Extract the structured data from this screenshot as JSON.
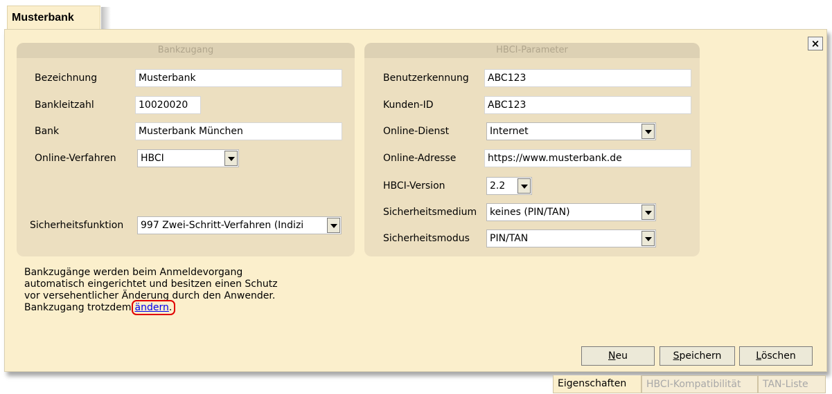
{
  "tab_title": "Musterbank",
  "close_label": "×",
  "bankzugang": {
    "header": "Bankzugang",
    "bezeichnung_label": "Bezeichnung",
    "bezeichnung_value": "Musterbank",
    "blz_label": "Bankleitzahl",
    "blz_value": "10020020",
    "bank_label": "Bank",
    "bank_value": "Musterbank München",
    "verfahren_label": "Online-Verfahren",
    "verfahren_value": "HBCI",
    "sicherheitsfunktion_label": "Sicherheitsfunktion",
    "sicherheitsfunktion_value": "997 Zwei-Schritt-Verfahren (Indizi"
  },
  "hbci": {
    "header": "HBCI-Parameter",
    "benutzer_label": "Benutzerkennung",
    "benutzer_value": "ABC123",
    "kunden_label": "Kunden-ID",
    "kunden_value": "ABC123",
    "dienst_label": "Online-Dienst",
    "dienst_value": "Internet",
    "adresse_label": "Online-Adresse",
    "adresse_value": "https://www.musterbank.de",
    "version_label": "HBCI-Version",
    "version_value": "2.2",
    "medium_label": "Sicherheitsmedium",
    "medium_value": "keines (PIN/TAN)",
    "modus_label": "Sicherheitsmodus",
    "modus_value": "PIN/TAN"
  },
  "info": {
    "line1": "Bankzugänge werden beim Anmeldevorgang",
    "line2": "automatisch eingerichtet und besitzen einen Schutz",
    "line3": "vor versehentlicher Änderung durch den Anwender.",
    "line4_prefix": "Bankzugang trotzdem",
    "link": "ändern",
    "suffix": "."
  },
  "buttons": {
    "neu_first": "N",
    "neu_rest": "eu",
    "speichern_first": "S",
    "speichern_rest": "peichern",
    "loeschen_first": "L",
    "loeschen_rest": "öschen"
  },
  "bottom_tabs": [
    "Eigenschaften",
    "HBCI-Kompatibilität",
    "TAN-Liste"
  ],
  "colors": {
    "panel": "#fbefcc",
    "group": "#ecdfc0",
    "link": "#0000ee",
    "highlight": "#e00000"
  }
}
